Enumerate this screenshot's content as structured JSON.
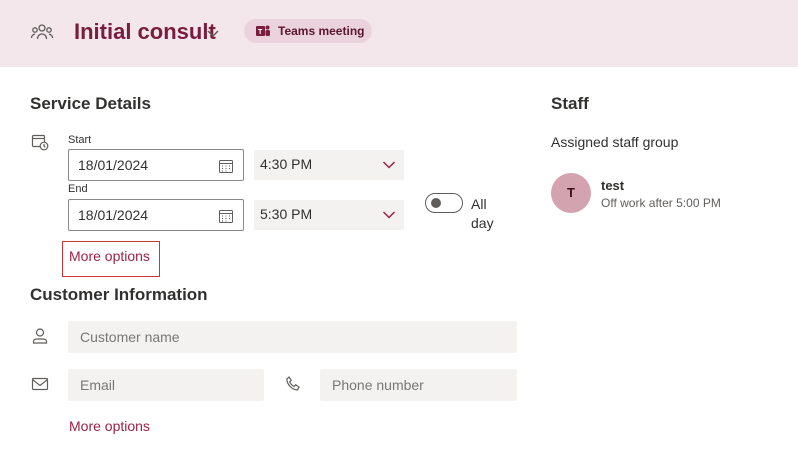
{
  "header": {
    "title": "Initial consult",
    "teams_label": "Teams meeting",
    "accent": "#7a1c3d"
  },
  "service": {
    "title": "Service Details",
    "start_label": "Start",
    "start_date": "18/01/2024",
    "start_time": "4:30 PM",
    "end_label": "End",
    "end_date": "18/01/2024",
    "end_time": "5:30 PM",
    "allday_label": "All day",
    "allday_on": false,
    "more_options": "More options"
  },
  "customer": {
    "title": "Customer Information",
    "name_placeholder": "Customer name",
    "email_placeholder": "Email",
    "phone_placeholder": "Phone number",
    "more_options": "More options"
  },
  "staff": {
    "title": "Staff",
    "group_label": "Assigned staff group",
    "member": {
      "initial": "T",
      "name": "test",
      "note": "Off work after 5:00 PM"
    }
  }
}
